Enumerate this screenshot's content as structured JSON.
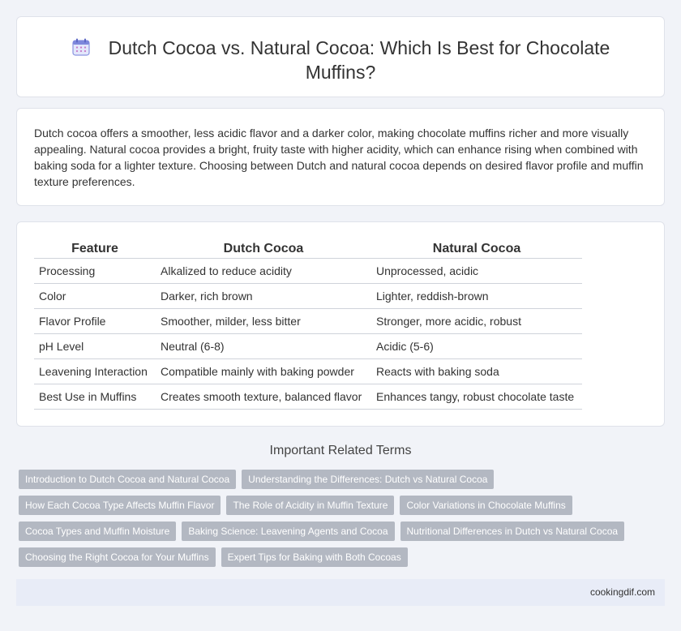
{
  "header": {
    "title": "Dutch Cocoa vs. Natural Cocoa: Which Is Best for Chocolate Muffins?",
    "icon": "calendar-icon"
  },
  "intro": {
    "text": "Dutch cocoa offers a smoother, less acidic flavor and a darker color, making chocolate muffins richer and more visually appealing. Natural cocoa provides a bright, fruity taste with higher acidity, which can enhance rising when combined with baking soda for a lighter texture. Choosing between Dutch and natural cocoa depends on desired flavor profile and muffin texture preferences."
  },
  "table": {
    "headers": [
      "Feature",
      "Dutch Cocoa",
      "Natural Cocoa"
    ],
    "rows": [
      [
        "Processing",
        "Alkalized to reduce acidity",
        "Unprocessed, acidic"
      ],
      [
        "Color",
        "Darker, rich brown",
        "Lighter, reddish-brown"
      ],
      [
        "Flavor Profile",
        "Smoother, milder, less bitter",
        "Stronger, more acidic, robust"
      ],
      [
        "pH Level",
        "Neutral (6-8)",
        "Acidic (5-6)"
      ],
      [
        "Leavening Interaction",
        "Compatible mainly with baking powder",
        "Reacts with baking soda"
      ],
      [
        "Best Use in Muffins",
        "Creates smooth texture, balanced flavor",
        "Enhances tangy, robust chocolate taste"
      ]
    ]
  },
  "related": {
    "heading": "Important Related Terms",
    "rows": [
      [
        "Introduction to Dutch Cocoa and Natural Cocoa",
        "Understanding the Differences: Dutch vs Natural Cocoa"
      ],
      [
        "How Each Cocoa Type Affects Muffin Flavor",
        "The Role of Acidity in Muffin Texture",
        "Color Variations in Chocolate Muffins"
      ],
      [
        "Cocoa Types and Muffin Moisture",
        "Baking Science: Leavening Agents and Cocoa",
        "Nutritional Differences in Dutch vs Natural Cocoa"
      ],
      [
        "Choosing the Right Cocoa for Your Muffins",
        "Expert Tips for Baking with Both Cocoas"
      ]
    ]
  },
  "footer": {
    "site": "cookingdif.com"
  },
  "colors": {
    "background": "#f1f3f8",
    "tag": "#b3b8c2",
    "footer": "#e8ecf7",
    "icon_accent": "#6f7bd6"
  }
}
